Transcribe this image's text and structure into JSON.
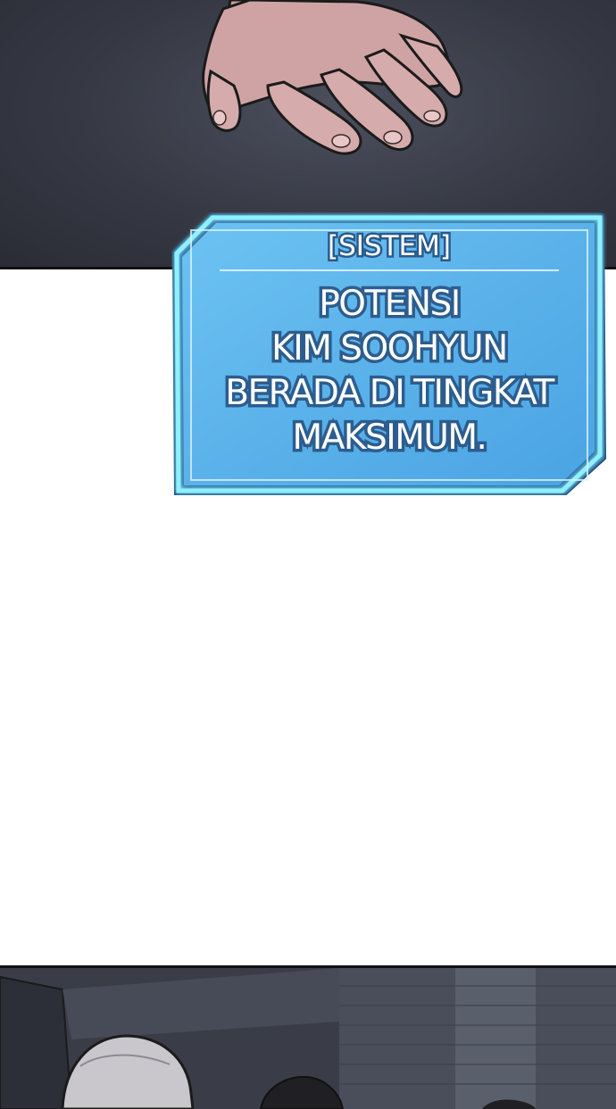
{
  "system_box": {
    "header": "[SISTEM]",
    "lines": [
      "POTENSI",
      "KIM SOOHYUN",
      "BERADA DI TINGKAT",
      "MAKSIMUM."
    ]
  },
  "colors": {
    "panel_bg": "#363944",
    "box_fill": "#5fb6ec",
    "box_glow": "#7fe3ff",
    "text_outline": "#2c5d8e"
  },
  "icons": [
    "hand-illustration",
    "character-silhouette-illustration"
  ]
}
